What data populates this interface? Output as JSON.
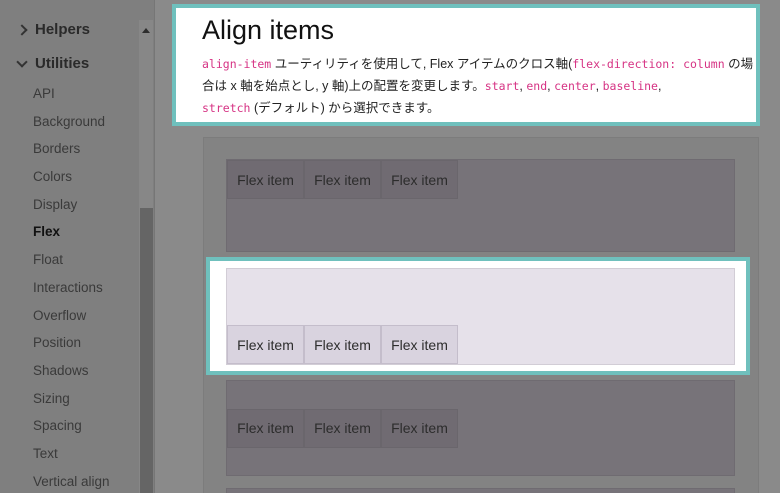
{
  "sidebar": {
    "helpers_label": "Helpers",
    "utilities_label": "Utilities",
    "items": [
      {
        "label": "API"
      },
      {
        "label": "Background"
      },
      {
        "label": "Borders"
      },
      {
        "label": "Colors"
      },
      {
        "label": "Display"
      },
      {
        "label": "Flex",
        "active": true
      },
      {
        "label": "Float"
      },
      {
        "label": "Interactions"
      },
      {
        "label": "Overflow"
      },
      {
        "label": "Position"
      },
      {
        "label": "Shadows"
      },
      {
        "label": "Sizing"
      },
      {
        "label": "Spacing"
      },
      {
        "label": "Text"
      },
      {
        "label": "Vertical align"
      }
    ]
  },
  "callout": {
    "title": "Align items",
    "code_align_item": "align-item",
    "text_1": " ユーティリティを使用して, Flex アイテムのクロス軸(",
    "code_flex_direction": "flex-direction: column",
    "text_2": " の場合は x 軸を始点とし, y 軸)上の配置を変更します。",
    "code_start": "start",
    "sep_1": ", ",
    "code_end": "end",
    "sep_2": ", ",
    "code_center": "center",
    "sep_3": ", ",
    "code_baseline": "baseline",
    "sep_4": ",",
    "code_stretch": "stretch",
    "text_3": " (デフォルト) から選択できます。"
  },
  "demos": {
    "item_label": "Flex item"
  },
  "colors": {
    "highlight_border": "#6fc0bd",
    "code_text": "#d63384",
    "demo_bg": "#e6e1ea",
    "item_bg": "#d9d3df"
  }
}
